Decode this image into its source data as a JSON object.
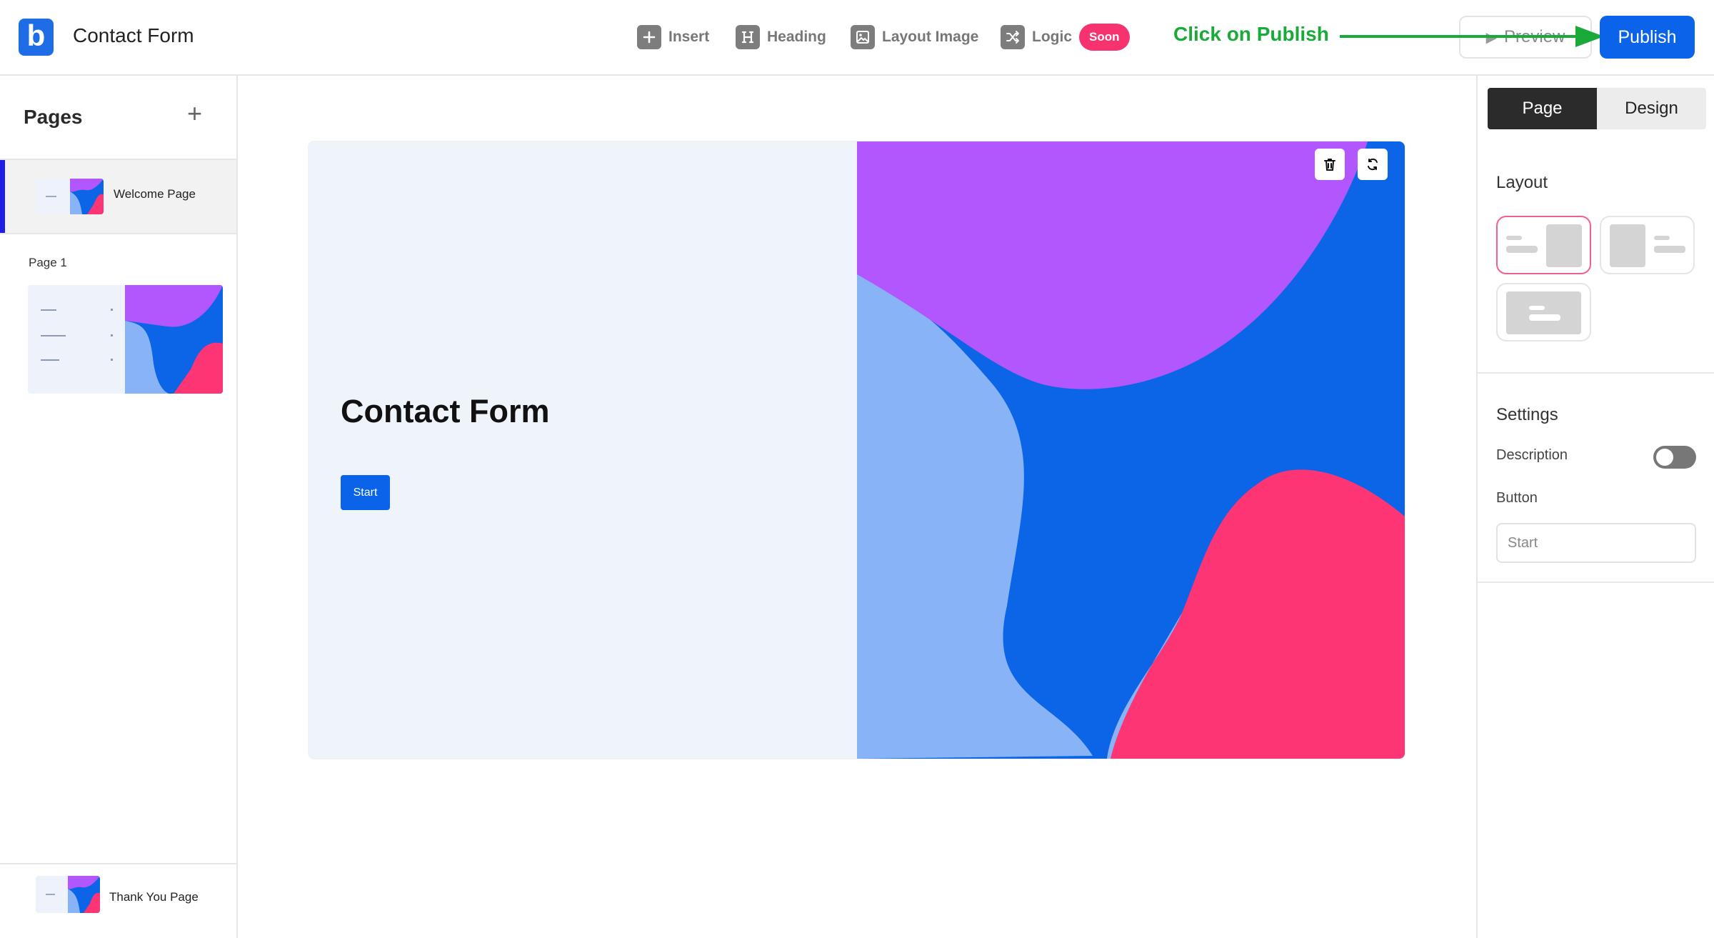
{
  "app": {
    "title": "Contact Form",
    "logo_letter": "b"
  },
  "toolbar": {
    "insert_label": "Insert",
    "heading_label": "Heading",
    "layout_image_label": "Layout Image",
    "logic_label": "Logic",
    "logic_badge": "Soon",
    "annotation": "Click on Publish",
    "preview_label": "Preview",
    "publish_label": "Publish"
  },
  "sidebar": {
    "title": "Pages",
    "pages": [
      {
        "label": "Welcome Page",
        "selected": true
      },
      {
        "label": "Page 1"
      },
      {
        "label": "Thank You Page"
      }
    ]
  },
  "canvas": {
    "title": "Contact Form",
    "start_label": "Start",
    "colors": {
      "purple": "#b257fe",
      "blue": "#0b65e6",
      "light_blue": "#88b3f7",
      "pink": "#fe3575",
      "panel_bg": "#eff4fb"
    }
  },
  "right_panel": {
    "tabs": [
      "Page",
      "Design"
    ],
    "active_tab": "Page",
    "layout_heading": "Layout",
    "settings_heading": "Settings",
    "description_label": "Description",
    "description_enabled": false,
    "button_label": "Button",
    "button_input_value": "Start"
  },
  "colors": {
    "accent": "#0a63e8",
    "annotation": "#1aaa3a",
    "badge": "#f7336f",
    "selected_layout_border": "#f0608e"
  }
}
